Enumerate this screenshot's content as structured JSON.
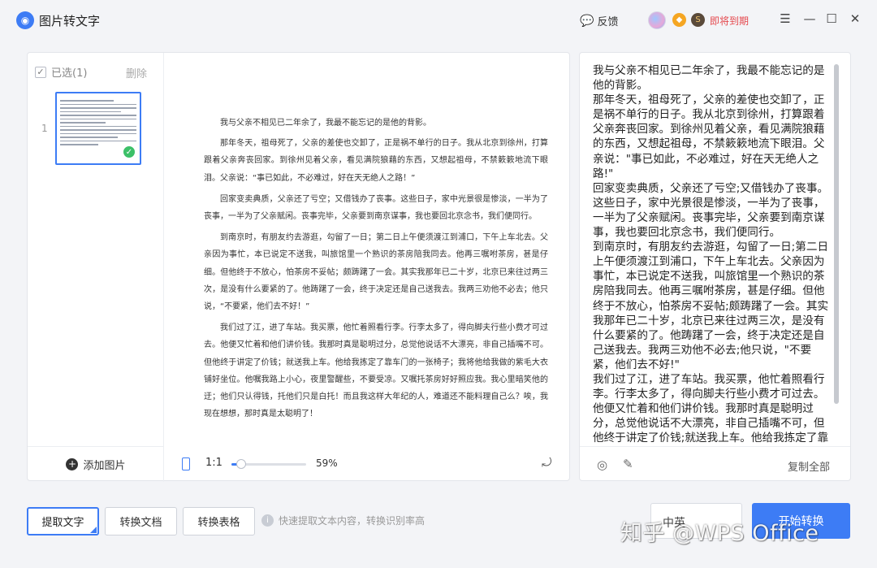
{
  "app": {
    "title": "图片转文字",
    "logo_glyph": "◉"
  },
  "header": {
    "feedback_label": "反馈",
    "expire_label": "即将到期",
    "badge_a": "◆",
    "badge_b": "S"
  },
  "sidebar": {
    "select_all_label": "已选(1)",
    "delete_label": "删除",
    "thumb_index": "1",
    "add_image_label": "添加图片"
  },
  "preview": {
    "paragraphs": [
      "我与父亲不相见已二年余了，我最不能忘记的是他的背影。",
      "那年冬天，祖母死了，父亲的差使也交卸了，正是祸不单行的日子。我从北京到徐州，打算跟着父亲奔丧回家。到徐州见着父亲，看见满院狼藉的东西，又想起祖母，不禁簌簌地流下眼泪。父亲说：“事已如此，不必难过，好在天无绝人之路！”",
      "回家变卖典质，父亲还了亏空；又借钱办了丧事。这些日子，家中光景很是惨淡，一半为了丧事，一半为了父亲赋闲。丧事完毕，父亲要到南京谋事，我也要回北京念书，我们便同行。",
      "到南京时，有朋友约去游逛，勾留了一日；第二日上午便须渡江到浦口，下午上车北去。父亲因为事忙，本已说定不送我，叫旅馆里一个熟识的茶房陪我同去。他再三嘱咐茶房，甚是仔细。但他终于不放心，怕茶房不妥帖；颇踌躇了一会。其实我那年已二十岁，北京已来往过两三次，是没有什么要紧的了。他踌躇了一会，终于决定还是自己送我去。我两三劝他不必去；他只说，“不要紧，他们去不好！”",
      "我们过了江，进了车站。我买票，他忙着照看行李。行李太多了，得向脚夫行些小费才可过去。他便又忙着和他们讲价钱。我那时真是聪明过分，总觉他说话不大漂亮，非自己插嘴不可。但他终于讲定了价钱；就送我上车。他给我拣定了靠车门的一张椅子；我将他给我做的紫毛大衣铺好坐位。他嘱我路上小心，夜里警醒些，不要受凉。又嘱托茶房好好照应我。我心里暗笑他的迂；他们只认得钱，托他们只是白托！而且我这样大年纪的人，难道还不能料理自己么？唉，我现在想想，那时真是太聪明了！"
    ],
    "ratio_label": "1:1",
    "zoom_percent": 59,
    "zoom_label": "59%"
  },
  "result": {
    "paragraphs": [
      "我与父亲不相见已二年余了，我最不能忘记的是他的背影。",
      "那年冬天，祖母死了，父亲的差使也交卸了，正是祸不单行的日子。我从北京到徐州，打算跟着父亲奔丧回家。到徐州见着父亲，看见满院狼藉的东西，又想起祖母，不禁簌簌地流下眼泪。父亲说：\"事已如此，不必难过，好在天无绝人之路!\"",
      "回家变卖典质，父亲还了亏空;又借钱办了丧事。这些日子，家中光景很是惨淡，一半为了丧事，一半为了父亲赋闲。丧事完毕，父亲要到南京谋事，我也要回北京念书，我们便同行。",
      "到南京时，有朋友约去游逛，勾留了一日;第二日上午便须渡江到浦口，下午上车北去。父亲因为事忙，本已说定不送我，叫旅馆里一个熟识的茶房陪我同去。他再三嘱咐茶房，甚是仔细。但他终于不放心，怕茶房不妥帖;颇踌躇了一会。其实我那年已二十岁，北京已来往过两三次，是没有什么要紧的了。他踌躇了一会，终于决定还是自己送我去。我两三劝他不必去;他只说，\"不要紧，他们去不好!\"",
      "我们过了江，进了车站。我买票，他忙着照看行李。行李太多了，得向脚夫行些小费才可过去。他便又忙着和他们讲价钱。我那时真是聪明过分，总觉他说话不大漂亮，非自己插嘴不可，但他终于讲定了价钱;就送我上车。他给我拣定了靠"
    ],
    "copy_all_label": "复制全部"
  },
  "bottom": {
    "extract_text_label": "提取文字",
    "convert_doc_label": "转换文档",
    "convert_table_label": "转换表格",
    "hint_text": "快速提取文本内容，转换识别率高",
    "language_value": "中英",
    "start_label": "开始转换"
  },
  "watermark": "知乎 @WPS Office",
  "colors": {
    "accent": "#3d7cf5",
    "expire": "#e5484d",
    "success": "#3cc068"
  }
}
